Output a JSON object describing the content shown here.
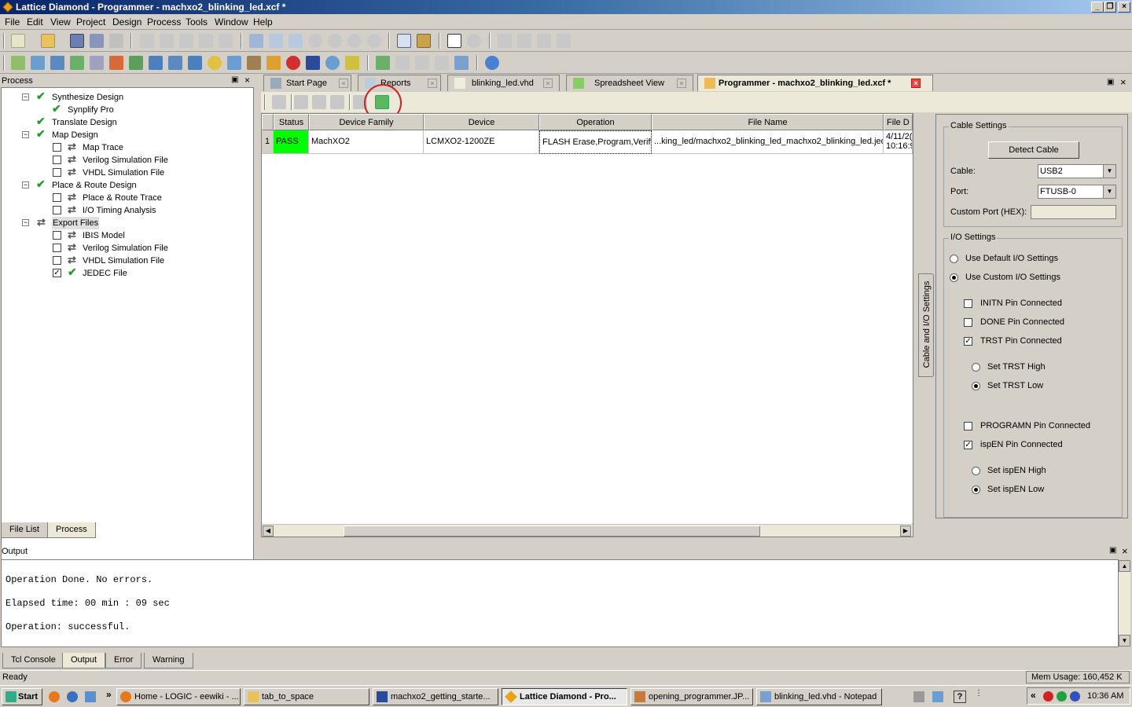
{
  "window": {
    "title": "Lattice Diamond - Programmer - machxo2_blinking_led.xcf *"
  },
  "menu": [
    "File",
    "Edit",
    "View",
    "Project",
    "Design",
    "Process",
    "Tools",
    "Window",
    "Help"
  ],
  "process_panel": {
    "title": "Process",
    "items": [
      {
        "label": "Synthesize Design",
        "state": "done",
        "level": 0
      },
      {
        "label": "Synplify Pro",
        "state": "done",
        "level": 1
      },
      {
        "label": "Translate Design",
        "state": "done",
        "level": 0
      },
      {
        "label": "Map Design",
        "state": "done",
        "level": 0
      },
      {
        "label": "Map Trace",
        "state": "pending",
        "level": 1
      },
      {
        "label": "Verilog Simulation File",
        "state": "pending",
        "level": 1
      },
      {
        "label": "VHDL Simulation File",
        "state": "pending",
        "level": 1
      },
      {
        "label": "Place & Route Design",
        "state": "done",
        "level": 0
      },
      {
        "label": "Place & Route Trace",
        "state": "pending",
        "level": 1
      },
      {
        "label": "I/O Timing Analysis",
        "state": "pending",
        "level": 1
      },
      {
        "label": "Export Files",
        "state": "pending",
        "level": 0
      },
      {
        "label": "IBIS Model",
        "state": "pending",
        "level": 1
      },
      {
        "label": "Verilog Simulation File",
        "state": "pending",
        "level": 1
      },
      {
        "label": "VHDL Simulation File",
        "state": "pending",
        "level": 1
      },
      {
        "label": "JEDEC File",
        "state": "done-checked",
        "level": 1
      }
    ],
    "tabs": [
      "File List",
      "Process"
    ]
  },
  "doc_tabs": [
    {
      "label": "Start Page"
    },
    {
      "label": "Reports"
    },
    {
      "label": "blinking_led.vhd"
    },
    {
      "label": "Spreadsheet View"
    },
    {
      "label": "Programmer - machxo2_blinking_led.xcf *"
    }
  ],
  "grid": {
    "headers": [
      "Status",
      "Device Family",
      "Device",
      "Operation",
      "File Name",
      "File D"
    ],
    "rows": [
      {
        "index": "1",
        "status": "PASS",
        "family": "MachXO2",
        "device": "LCMXO2-1200ZE",
        "operation": "FLASH Erase,Program,Verify",
        "file": "...king_led/machxo2_blinking_led_machxo2_blinking_led.jed",
        "date1": "4/11/2(",
        "date2": "10:16:9"
      }
    ],
    "pass_color": "#00ff00"
  },
  "side_tab": "Cable and I/O Settings",
  "cable": {
    "title": "Cable Settings",
    "detect_button": "Detect Cable",
    "cable_label": "Cable:",
    "cable_value": "USB2",
    "port_label": "Port:",
    "port_value": "FTUSB-0",
    "custom_port_label": "Custom Port (HEX):",
    "custom_port_value": ""
  },
  "io": {
    "title": "I/O Settings",
    "use_default": "Use Default I/O Settings",
    "use_custom": "Use Custom I/O Settings",
    "initn": "INITN Pin Connected",
    "done": "DONE Pin Connected",
    "trst": "TRST Pin Connected",
    "trst_high": "Set TRST High",
    "trst_low": "Set TRST Low",
    "programn": "PROGRAMN Pin Connected",
    "ispen": "ispEN Pin Connected",
    "ispen_high": "Set ispEN High",
    "ispen_low": "Set ispEN Low"
  },
  "output": {
    "title": "Output",
    "lines": [
      "Operation Done. No errors.",
      "Elapsed time: 00 min : 09 sec",
      "Operation: successful."
    ],
    "tabs": [
      "Tcl Console",
      "Output",
      "Error",
      "Warning"
    ]
  },
  "status": {
    "text": "Ready",
    "mem": "Mem Usage: 160,452 K"
  },
  "taskbar": {
    "start": "Start",
    "tasks": [
      "Home - LOGIC - eewiki - ...",
      "tab_to_space",
      "machxo2_getting_starte...",
      "Lattice Diamond - Pro...",
      "opening_programmer.JP...",
      "blinking_led.vhd - Notepad"
    ],
    "clock": "10:36 AM"
  }
}
